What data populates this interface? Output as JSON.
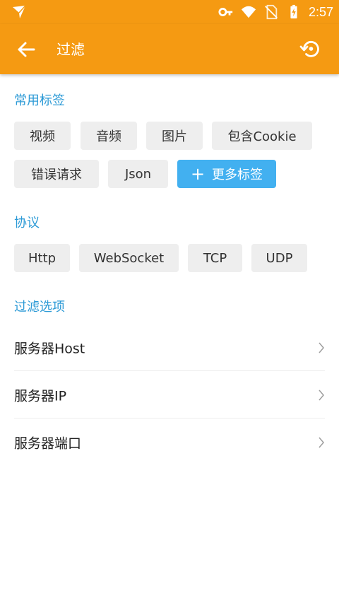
{
  "status_bar": {
    "time": "2:57",
    "icons": [
      "app-notification-icon",
      "vpn-key-icon",
      "wifi-icon",
      "no-sim-icon",
      "battery-charging-icon"
    ]
  },
  "app_bar": {
    "title": "过滤",
    "back_icon": "arrow-left-icon",
    "action_icon": "restore-icon"
  },
  "sections": {
    "tags": {
      "title": "常用标签",
      "chips": [
        "视频",
        "音频",
        "图片",
        "包含Cookie",
        "错误请求",
        "Json"
      ],
      "add_label": "更多标签"
    },
    "protocol": {
      "title": "协议",
      "chips": [
        "Http",
        "WebSocket",
        "TCP",
        "UDP"
      ]
    },
    "filters": {
      "title": "过滤选项",
      "items": [
        "服务器Host",
        "服务器IP",
        "服务器端口"
      ]
    }
  },
  "colors": {
    "primary": "#f59a12",
    "accent": "#2c9ad6",
    "chip_bg": "#eeeeee",
    "add_chip_bg": "#42b0f0"
  }
}
